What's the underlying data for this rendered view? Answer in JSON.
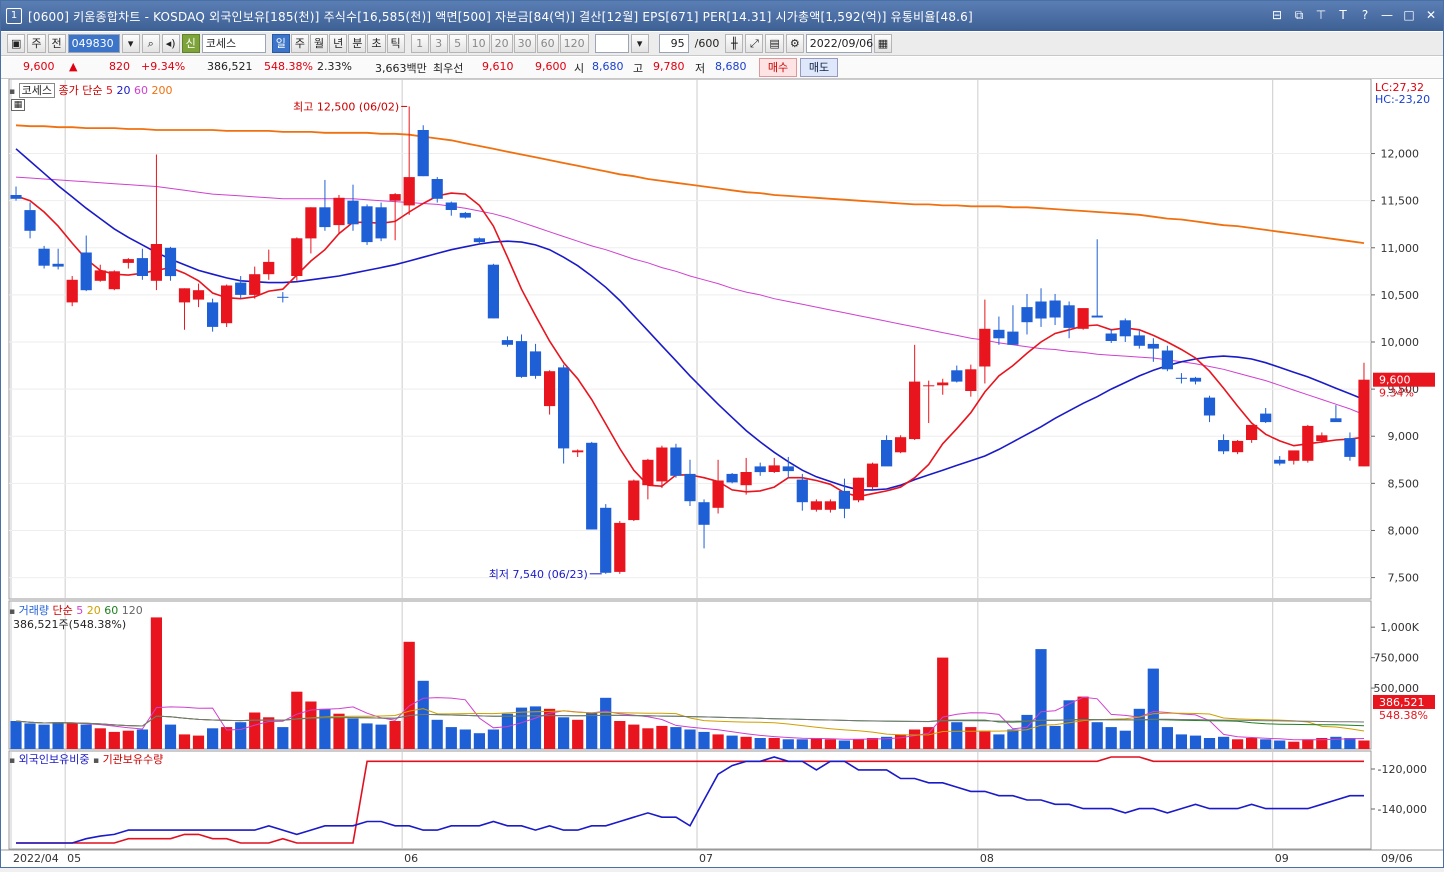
{
  "window": {
    "number": "1",
    "title": "[0600] 키움종합차트 - KOSDAQ 외국인보유[185(천)] 주식수[16,585(천)] 액면[500] 자본금[84(억)] 결산[12월] EPS[671] PER[14.31] 시가총액[1,592(억)] 유통비율[48.6]"
  },
  "toolbar": {
    "period_type": "주",
    "market": "전",
    "code": "049830",
    "category_badge": "신",
    "stock_name": "코세스",
    "periods": [
      "일",
      "주",
      "월",
      "년",
      "분",
      "초",
      "틱"
    ],
    "selected_period": "일",
    "intervals": [
      "1",
      "3",
      "5",
      "10",
      "20",
      "30",
      "60",
      "120"
    ],
    "count": "95",
    "count_total": "/600",
    "date": "2022/09/06"
  },
  "quote": {
    "price": "9,600",
    "arrow": "▲",
    "change": "820",
    "change_pct": "+9.34%",
    "volume": "386,521",
    "volume_ratio": "548.38%",
    "turnover": "2.33%",
    "amount": "3,663백만",
    "best_ask_label": "최우선",
    "best_ask": "9,610",
    "best_bid": "9,600",
    "open_label": "시",
    "open": "8,680",
    "high_label": "고",
    "high": "9,780",
    "low_label": "저",
    "low": "8,680",
    "buy_label": "매수",
    "sell_label": "매도"
  },
  "price_panel": {
    "stock_box": "코세스",
    "legend_main": "종가 단순",
    "ma_periods": [
      "5",
      "20",
      "60",
      "200"
    ],
    "lc": "LC:27,32",
    "hc": "HC:-23,20",
    "high_annotation": "최고 12,500 (06/02)",
    "low_annotation": "최저 7,540 (06/23)",
    "current_price_tag": "9,600",
    "current_pct_tag": "9.34%",
    "axis_labels": [
      "12,000",
      "11,500",
      "11,000",
      "10,500",
      "10,000",
      "9,500",
      "9,000",
      "8,500",
      "8,000",
      "7,500"
    ]
  },
  "volume_panel": {
    "title": "거래량",
    "legend_main": "단순",
    "ma_periods": [
      "5",
      "20",
      "60",
      "120"
    ],
    "current": "386,521주(548.38%)",
    "axis_labels": [
      "1,000K",
      "750,000",
      "500,000"
    ],
    "current_tag": "386,521",
    "current_pct_tag": "548.38%"
  },
  "holding_panel": {
    "series1": "외국인보유비중",
    "series2": "기관보유수량",
    "axis_labels": [
      "-120,000",
      "-140,000"
    ]
  },
  "x_axis": {
    "labels": [
      "2022/04",
      "05",
      "06",
      "07",
      "08",
      "09"
    ],
    "right_label": "09/06"
  },
  "colors": {
    "up": "#e8141e",
    "down": "#1f5fd6",
    "ma5": "#e8141e",
    "ma20": "#1a1ac8",
    "ma60": "#d040d0",
    "ma200": "#f07010"
  },
  "chart_data": {
    "type": "candlestick",
    "price_range": [
      7400,
      12600
    ],
    "candles": [
      {
        "o": 11560,
        "h": 11650,
        "l": 11500,
        "c": 11520
      },
      {
        "o": 11400,
        "h": 11480,
        "l": 11100,
        "c": 11180
      },
      {
        "o": 10990,
        "h": 11020,
        "l": 10780,
        "c": 10810
      },
      {
        "o": 10830,
        "h": 10990,
        "l": 10770,
        "c": 10800
      },
      {
        "o": 10420,
        "h": 10700,
        "l": 10380,
        "c": 10660
      },
      {
        "o": 10950,
        "h": 11130,
        "l": 10540,
        "c": 10550
      },
      {
        "o": 10650,
        "h": 10820,
        "l": 10640,
        "c": 10760
      },
      {
        "o": 10560,
        "h": 10760,
        "l": 10550,
        "c": 10750
      },
      {
        "o": 10840,
        "h": 10890,
        "l": 10780,
        "c": 10880
      },
      {
        "o": 10890,
        "h": 10990,
        "l": 10660,
        "c": 10700
      },
      {
        "o": 10650,
        "h": 11990,
        "l": 10550,
        "c": 11040
      },
      {
        "o": 11000,
        "h": 11010,
        "l": 10650,
        "c": 10700
      },
      {
        "o": 10420,
        "h": 10570,
        "l": 10130,
        "c": 10570
      },
      {
        "o": 10450,
        "h": 10620,
        "l": 10370,
        "c": 10550
      },
      {
        "o": 10420,
        "h": 10460,
        "l": 10110,
        "c": 10160
      },
      {
        "o": 10200,
        "h": 10610,
        "l": 10160,
        "c": 10600
      },
      {
        "o": 10630,
        "h": 10700,
        "l": 10460,
        "c": 10500
      },
      {
        "o": 10500,
        "h": 10800,
        "l": 10460,
        "c": 10720
      },
      {
        "o": 10720,
        "h": 10980,
        "l": 10660,
        "c": 10850
      },
      {
        "o": 10480,
        "h": 10530,
        "l": 10420,
        "c": 10470
      },
      {
        "o": 10700,
        "h": 11110,
        "l": 10650,
        "c": 11100
      },
      {
        "o": 11100,
        "h": 11430,
        "l": 10940,
        "c": 11430
      },
      {
        "o": 11430,
        "h": 11720,
        "l": 11180,
        "c": 11220
      },
      {
        "o": 11240,
        "h": 11560,
        "l": 11140,
        "c": 11530
      },
      {
        "o": 11500,
        "h": 11670,
        "l": 11180,
        "c": 11250
      },
      {
        "o": 11440,
        "h": 11460,
        "l": 11030,
        "c": 11060
      },
      {
        "o": 11430,
        "h": 11480,
        "l": 11070,
        "c": 11100
      },
      {
        "o": 11500,
        "h": 11580,
        "l": 11080,
        "c": 11570
      },
      {
        "o": 11450,
        "h": 12500,
        "l": 11350,
        "c": 11750
      },
      {
        "o": 12250,
        "h": 12300,
        "l": 11760,
        "c": 11760
      },
      {
        "o": 11730,
        "h": 11750,
        "l": 11480,
        "c": 11520
      },
      {
        "o": 11480,
        "h": 11490,
        "l": 11340,
        "c": 11400
      },
      {
        "o": 11370,
        "h": 11380,
        "l": 11310,
        "c": 11320
      },
      {
        "o": 11100,
        "h": 11110,
        "l": 11050,
        "c": 11060
      },
      {
        "o": 10820,
        "h": 10830,
        "l": 10250,
        "c": 10250
      },
      {
        "o": 10020,
        "h": 10060,
        "l": 9950,
        "c": 9970
      },
      {
        "o": 10010,
        "h": 10080,
        "l": 9620,
        "c": 9630
      },
      {
        "o": 9900,
        "h": 9980,
        "l": 9610,
        "c": 9640
      },
      {
        "o": 9320,
        "h": 9700,
        "l": 9230,
        "c": 9690
      },
      {
        "o": 9730,
        "h": 9760,
        "l": 8710,
        "c": 8870
      },
      {
        "o": 8830,
        "h": 8860,
        "l": 8780,
        "c": 8850
      },
      {
        "o": 8930,
        "h": 8940,
        "l": 8010,
        "c": 8010
      },
      {
        "o": 8240,
        "h": 8280,
        "l": 7540,
        "c": 7550
      },
      {
        "o": 7560,
        "h": 8100,
        "l": 7540,
        "c": 8080
      },
      {
        "o": 8110,
        "h": 8540,
        "l": 8100,
        "c": 8530
      },
      {
        "o": 8480,
        "h": 8760,
        "l": 8330,
        "c": 8750
      },
      {
        "o": 8520,
        "h": 8900,
        "l": 8450,
        "c": 8880
      },
      {
        "o": 8880,
        "h": 8920,
        "l": 8560,
        "c": 8580
      },
      {
        "o": 8600,
        "h": 8750,
        "l": 8260,
        "c": 8310
      },
      {
        "o": 8300,
        "h": 8330,
        "l": 7810,
        "c": 8060
      },
      {
        "o": 8240,
        "h": 8750,
        "l": 8180,
        "c": 8530
      },
      {
        "o": 8600,
        "h": 8610,
        "l": 8500,
        "c": 8510
      },
      {
        "o": 8480,
        "h": 8770,
        "l": 8380,
        "c": 8620
      },
      {
        "o": 8680,
        "h": 8720,
        "l": 8580,
        "c": 8620
      },
      {
        "o": 8620,
        "h": 8770,
        "l": 8610,
        "c": 8690
      },
      {
        "o": 8680,
        "h": 8780,
        "l": 8560,
        "c": 8630
      },
      {
        "o": 8540,
        "h": 8600,
        "l": 8210,
        "c": 8300
      },
      {
        "o": 8220,
        "h": 8330,
        "l": 8200,
        "c": 8310
      },
      {
        "o": 8220,
        "h": 8330,
        "l": 8190,
        "c": 8310
      },
      {
        "o": 8420,
        "h": 8550,
        "l": 8130,
        "c": 8230
      },
      {
        "o": 8320,
        "h": 8560,
        "l": 8300,
        "c": 8560
      },
      {
        "o": 8460,
        "h": 8720,
        "l": 8440,
        "c": 8710
      },
      {
        "o": 8960,
        "h": 9010,
        "l": 8720,
        "c": 8680
      },
      {
        "o": 8830,
        "h": 9010,
        "l": 8820,
        "c": 8990
      },
      {
        "o": 8970,
        "h": 9970,
        "l": 8960,
        "c": 9580
      },
      {
        "o": 9540,
        "h": 9590,
        "l": 9140,
        "c": 9540
      },
      {
        "o": 9540,
        "h": 9610,
        "l": 9440,
        "c": 9570
      },
      {
        "o": 9700,
        "h": 9750,
        "l": 9570,
        "c": 9580
      },
      {
        "o": 9480,
        "h": 9760,
        "l": 9420,
        "c": 9710
      },
      {
        "o": 9740,
        "h": 10450,
        "l": 9560,
        "c": 10140
      },
      {
        "o": 10130,
        "h": 10270,
        "l": 9970,
        "c": 10040
      },
      {
        "o": 10110,
        "h": 10390,
        "l": 10080,
        "c": 9970
      },
      {
        "o": 10370,
        "h": 10510,
        "l": 10080,
        "c": 10210
      },
      {
        "o": 10430,
        "h": 10570,
        "l": 10160,
        "c": 10250
      },
      {
        "o": 10440,
        "h": 10510,
        "l": 10180,
        "c": 10260
      },
      {
        "o": 10390,
        "h": 10430,
        "l": 10040,
        "c": 10150
      },
      {
        "o": 10140,
        "h": 10270,
        "l": 10130,
        "c": 10360
      },
      {
        "o": 10280,
        "h": 11090,
        "l": 10270,
        "c": 10260
      },
      {
        "o": 10090,
        "h": 10140,
        "l": 9990,
        "c": 10010
      },
      {
        "o": 10230,
        "h": 10250,
        "l": 10000,
        "c": 10060
      },
      {
        "o": 10070,
        "h": 10120,
        "l": 9930,
        "c": 9960
      },
      {
        "o": 9980,
        "h": 10040,
        "l": 9790,
        "c": 9930
      },
      {
        "o": 9910,
        "h": 9960,
        "l": 9690,
        "c": 9710
      },
      {
        "o": 9620,
        "h": 9670,
        "l": 9560,
        "c": 9610
      },
      {
        "o": 9620,
        "h": 9630,
        "l": 9550,
        "c": 9580
      },
      {
        "o": 9410,
        "h": 9430,
        "l": 9150,
        "c": 9220
      },
      {
        "o": 8960,
        "h": 9020,
        "l": 8810,
        "c": 8840
      },
      {
        "o": 8830,
        "h": 8960,
        "l": 8810,
        "c": 8950
      },
      {
        "o": 8960,
        "h": 9110,
        "l": 8930,
        "c": 9120
      },
      {
        "o": 9240,
        "h": 9300,
        "l": 9140,
        "c": 9150
      },
      {
        "o": 8750,
        "h": 8790,
        "l": 8690,
        "c": 8710
      },
      {
        "o": 8740,
        "h": 8800,
        "l": 8700,
        "c": 8850
      },
      {
        "o": 8740,
        "h": 9120,
        "l": 8720,
        "c": 9110
      },
      {
        "o": 8950,
        "h": 9040,
        "l": 8930,
        "c": 9010
      },
      {
        "o": 9190,
        "h": 9330,
        "l": 9160,
        "c": 9150
      },
      {
        "o": 8980,
        "h": 9040,
        "l": 8740,
        "c": 8780
      },
      {
        "o": 8680,
        "h": 9780,
        "l": 8680,
        "c": 9600
      }
    ],
    "ma5": [
      11550,
      11500,
      11380,
      11230,
      11050,
      10880,
      10760,
      10720,
      10710,
      10730,
      10760,
      10790,
      10730,
      10650,
      10520,
      10470,
      10460,
      10480,
      10540,
      10560,
      10710,
      10860,
      10980,
      11150,
      11270,
      11270,
      11260,
      11280,
      11380,
      11470,
      11550,
      11580,
      11570,
      11450,
      11230,
      10900,
      10560,
      10280,
      10010,
      9780,
      9610,
      9390,
      9130,
      8870,
      8640,
      8480,
      8470,
      8590,
      8590,
      8560,
      8520,
      8430,
      8410,
      8420,
      8460,
      8560,
      8560,
      8530,
      8490,
      8400,
      8360,
      8390,
      8420,
      8460,
      8560,
      8700,
      8920,
      9080,
      9250,
      9470,
      9640,
      9750,
      9880,
      10000,
      10090,
      10130,
      10170,
      10180,
      10130,
      10150,
      10130,
      10070,
      10000,
      9920,
      9830,
      9690,
      9510,
      9320,
      9140,
      9020,
      8950,
      8900,
      8920,
      8940,
      8960,
      8970,
      8990
    ],
    "ma20": [
      12050,
      11920,
      11790,
      11660,
      11540,
      11420,
      11310,
      11200,
      11110,
      11030,
      10950,
      10880,
      10820,
      10760,
      10720,
      10680,
      10650,
      10640,
      10630,
      10630,
      10640,
      10660,
      10680,
      10700,
      10730,
      10760,
      10790,
      10820,
      10860,
      10900,
      10940,
      10980,
      11010,
      11040,
      11060,
      11070,
      11060,
      11030,
      10980,
      10900,
      10810,
      10700,
      10580,
      10440,
      10280,
      10120,
      9960,
      9800,
      9640,
      9490,
      9340,
      9200,
      9060,
      8940,
      8830,
      8730,
      8640,
      8570,
      8520,
      8470,
      8430,
      8430,
      8440,
      8480,
      8540,
      8590,
      8640,
      8690,
      8740,
      8790,
      8860,
      8940,
      9020,
      9100,
      9190,
      9270,
      9350,
      9420,
      9500,
      9570,
      9640,
      9700,
      9750,
      9790,
      9820,
      9840,
      9850,
      9840,
      9820,
      9780,
      9730,
      9680,
      9630,
      9570,
      9510,
      9450,
      9390
    ],
    "ma60": [
      11750,
      11740,
      11730,
      11720,
      11710,
      11700,
      11690,
      11680,
      11670,
      11660,
      11650,
      11630,
      11610,
      11590,
      11570,
      11560,
      11550,
      11540,
      11530,
      11520,
      11520,
      11520,
      11520,
      11520,
      11520,
      11510,
      11500,
      11490,
      11480,
      11470,
      11460,
      11440,
      11420,
      11390,
      11360,
      11320,
      11270,
      11220,
      11170,
      11120,
      11070,
      11020,
      10980,
      10930,
      10880,
      10840,
      10790,
      10750,
      10700,
      10660,
      10620,
      10570,
      10530,
      10500,
      10460,
      10430,
      10400,
      10370,
      10340,
      10310,
      10280,
      10250,
      10220,
      10190,
      10160,
      10130,
      10100,
      10070,
      10040,
      10020,
      9990,
      9970,
      9950,
      9930,
      9920,
      9900,
      9890,
      9870,
      9860,
      9850,
      9840,
      9830,
      9810,
      9790,
      9770,
      9740,
      9710,
      9670,
      9630,
      9590,
      9540,
      9490,
      9440,
      9390,
      9340,
      9290,
      9230
    ],
    "ma200": [
      12300,
      12290,
      12290,
      12280,
      12280,
      12270,
      12270,
      12270,
      12260,
      12260,
      12250,
      12250,
      12250,
      12250,
      12250,
      12240,
      12240,
      12240,
      12240,
      12230,
      12230,
      12230,
      12220,
      12220,
      12220,
      12220,
      12210,
      12210,
      12200,
      12180,
      12160,
      12140,
      12110,
      12080,
      12050,
      12020,
      11990,
      11960,
      11930,
      11900,
      11870,
      11840,
      11810,
      11780,
      11760,
      11730,
      11710,
      11690,
      11670,
      11650,
      11630,
      11610,
      11590,
      11580,
      11560,
      11550,
      11540,
      11530,
      11520,
      11510,
      11500,
      11490,
      11480,
      11470,
      11460,
      11460,
      11450,
      11450,
      11440,
      11440,
      11440,
      11430,
      11430,
      11420,
      11410,
      11400,
      11390,
      11380,
      11370,
      11360,
      11350,
      11330,
      11310,
      11300,
      11280,
      11260,
      11240,
      11230,
      11210,
      11190,
      11170,
      11150,
      11130,
      11110,
      11090,
      11070,
      11050
    ],
    "volume": [
      230,
      210,
      200,
      220,
      210,
      200,
      170,
      140,
      150,
      160,
      1080,
      200,
      120,
      110,
      170,
      180,
      220,
      300,
      260,
      180,
      470,
      390,
      330,
      290,
      250,
      210,
      200,
      230,
      880,
      560,
      240,
      180,
      160,
      130,
      160,
      290,
      340,
      350,
      330,
      260,
      240,
      300,
      420,
      230,
      200,
      170,
      190,
      180,
      160,
      140,
      120,
      110,
      100,
      90,
      90,
      80,
      80,
      90,
      80,
      70,
      80,
      90,
      100,
      120,
      160,
      180,
      750,
      220,
      180,
      150,
      120,
      160,
      280,
      820,
      190,
      400,
      430,
      220,
      180,
      150,
      330,
      660,
      180,
      120,
      110,
      90,
      100,
      80,
      90,
      80,
      70,
      60,
      80,
      90,
      100,
      90,
      70,
      90,
      110,
      390
    ],
    "foreign_ratio": [
      0,
      0,
      0,
      0,
      0,
      5,
      8,
      10,
      15,
      15,
      15,
      15,
      15,
      15,
      15,
      15,
      15,
      15,
      20,
      15,
      10,
      15,
      20,
      20,
      20,
      25,
      25,
      20,
      20,
      15,
      15,
      20,
      20,
      20,
      25,
      20,
      20,
      15,
      20,
      15,
      15,
      20,
      20,
      25,
      30,
      35,
      30,
      30,
      20,
      50,
      80,
      90,
      95,
      95,
      100,
      95,
      95,
      85,
      95,
      95,
      85,
      85,
      85,
      75,
      75,
      70,
      70,
      65,
      60,
      60,
      55,
      55,
      50,
      50,
      45,
      45,
      40,
      40,
      40,
      35,
      40,
      40,
      35,
      40,
      45,
      40,
      40,
      40,
      45,
      40,
      40,
      40,
      40,
      45,
      50,
      55,
      55
    ],
    "institution": [
      0,
      0,
      0,
      0,
      0,
      0,
      0,
      0,
      5,
      5,
      5,
      5,
      10,
      10,
      5,
      5,
      0,
      0,
      0,
      5,
      0,
      0,
      0,
      0,
      0,
      95,
      95,
      95,
      95,
      95,
      95,
      95,
      95,
      95,
      95,
      95,
      95,
      95,
      95,
      95,
      95,
      95,
      95,
      95,
      95,
      95,
      95,
      95,
      95,
      95,
      95,
      95,
      95,
      95,
      95,
      95,
      95,
      95,
      95,
      95,
      95,
      95,
      95,
      95,
      95,
      95,
      95,
      95,
      95,
      95,
      95,
      95,
      95,
      95,
      95,
      95,
      95,
      95,
      100,
      100,
      100,
      95,
      95,
      95,
      95,
      95,
      95,
      95,
      95,
      95,
      95,
      95,
      95,
      95,
      95,
      95,
      95
    ]
  }
}
